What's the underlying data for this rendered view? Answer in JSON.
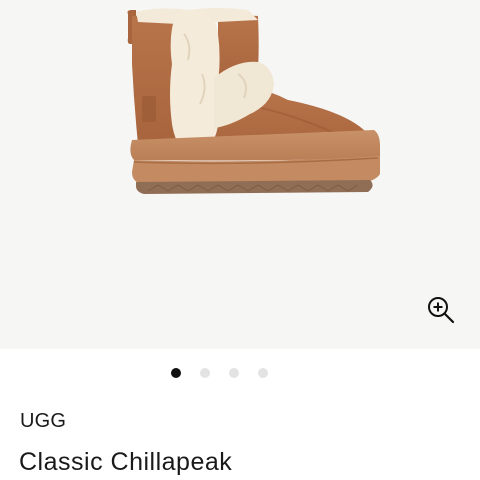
{
  "gallery": {
    "image_alt": "",
    "zoom_icon": "zoom-in-icon",
    "slide_count": 4,
    "active_slide": 1
  },
  "product": {
    "brand": "UGG",
    "name": "Classic Chillapeak"
  },
  "colors": {
    "gallery_background": "#f6f6f5",
    "active_dot": "#111111",
    "inactive_dot": "#e3e3e3",
    "text": "#1a1a1a"
  }
}
